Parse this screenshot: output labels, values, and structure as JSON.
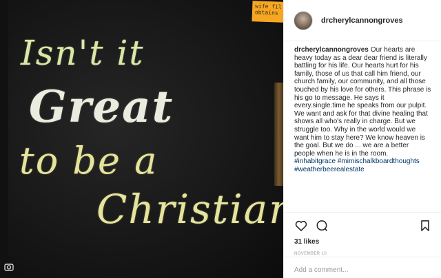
{
  "photo": {
    "chalk_lines": [
      "Isn't it",
      "Great",
      "to be a",
      "Christian"
    ],
    "sticky_note": "wife fil obtains"
  },
  "post": {
    "header_username": "drcherylcannongroves",
    "caption_username": "drcherylcannongroves",
    "caption_text": "Our hearts are heavy today as a dear dear friend is literally battling for his life. Our hearts hurt for his family, those of us that call him friend, our church family, our community, and all those touched by his love for others. This phrase is his go to message. He says it every.single.time he speaks from our pulpit. We want and ask for that divine healing that shows all who's really in charge. But we struggle too. Why in the world would we want him to stay here? We know heaven is the goal. But we do ... we are a better people when he is in the room.",
    "hashtags": [
      "#inhabitgrace",
      "#mimischalkboardthoughts",
      "#weatherbeerealestate"
    ],
    "likes": "31 likes",
    "date": "NOVEMBER 10",
    "comment_placeholder": "Add a comment..."
  },
  "icons": {
    "like": "heart-icon",
    "comment": "comment-bubble-icon",
    "save": "bookmark-icon",
    "camera": "camera-icon"
  },
  "colors": {
    "hashtag": "#003569",
    "text": "#262626",
    "muted": "#999999"
  }
}
